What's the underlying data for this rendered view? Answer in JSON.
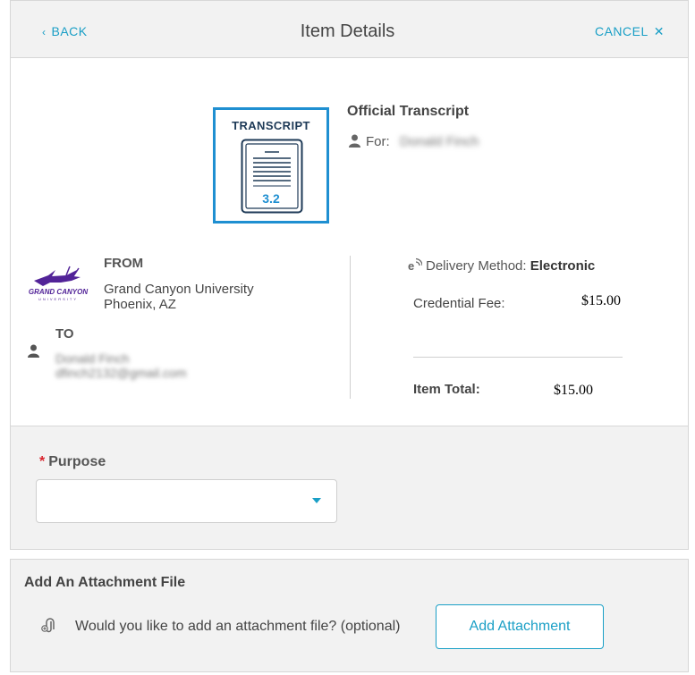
{
  "header": {
    "back_label": "BACK",
    "title": "Item Details",
    "cancel_label": "CANCEL",
    "cancel_icon": "close-icon"
  },
  "item": {
    "doc_badge": "TRANSCRIPT",
    "doc_version": "3.2",
    "title": "Official Transcript",
    "for_label": "For:",
    "for_name": "Donald Finch"
  },
  "from": {
    "label": "FROM",
    "logo_text": "GRAND CANYON",
    "logo_subtext": "UNIVERSITY",
    "school": "Grand Canyon University",
    "location": "Phoenix, AZ"
  },
  "to": {
    "label": "TO",
    "name": "Donald Finch",
    "email": "dfinch2132@gmail.com"
  },
  "delivery": {
    "label": "Delivery Method:",
    "value": "Electronic"
  },
  "fees": {
    "fee_label": "Credential Fee:",
    "fee_value": "$15.00",
    "total_label": "Item Total:",
    "total_value": "$15.00"
  },
  "purpose": {
    "required_mark": "*",
    "label": "Purpose",
    "selected": ""
  },
  "attachment": {
    "title": "Add An Attachment File",
    "question": "Would you like to add an attachment file? (optional)",
    "button_label": "Add Attachment"
  },
  "colors": {
    "accent": "#1a9fc6",
    "doc_border": "#1f8fd1",
    "required": "#d9242d",
    "logo_purple": "#522398"
  }
}
